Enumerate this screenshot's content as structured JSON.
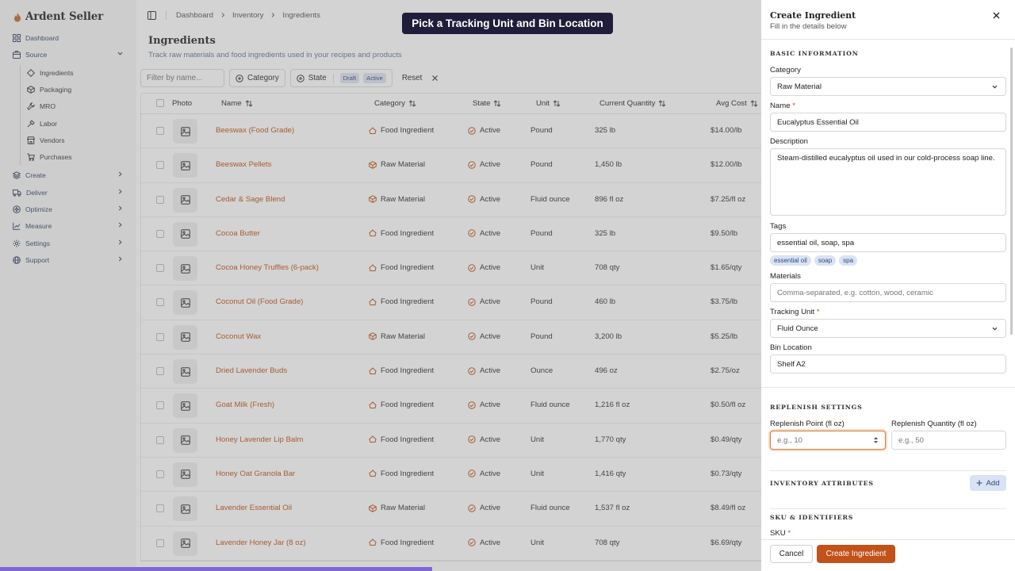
{
  "brand": {
    "name": "Ardent Seller"
  },
  "sidebar": {
    "items": [
      {
        "label": "Dashboard",
        "icon": "grid-icon"
      },
      {
        "label": "Source",
        "icon": "box-icon",
        "expanded": true
      },
      {
        "label": "Create",
        "icon": "layers-icon"
      },
      {
        "label": "Deliver",
        "icon": "truck-icon"
      },
      {
        "label": "Optimize",
        "icon": "sparkle-icon"
      },
      {
        "label": "Measure",
        "icon": "chart-icon"
      },
      {
        "label": "Settings",
        "icon": "gear-icon"
      },
      {
        "label": "Support",
        "icon": "globe-icon"
      }
    ],
    "source_items": [
      {
        "label": "Ingredients",
        "icon": "diamond-icon"
      },
      {
        "label": "Packaging",
        "icon": "package-icon"
      },
      {
        "label": "MRO",
        "icon": "wrench-icon"
      },
      {
        "label": "Labor",
        "icon": "hammer-icon"
      },
      {
        "label": "Vendors",
        "icon": "store-icon"
      },
      {
        "label": "Purchases",
        "icon": "cart-icon"
      }
    ]
  },
  "breadcrumb": [
    "Dashboard",
    "Inventory",
    "Ingredients"
  ],
  "page": {
    "title": "Ingredients",
    "subtitle": "Track raw materials and food ingredients used in your recipes and products"
  },
  "filters": {
    "placeholder": "Filter by name...",
    "category_label": "Category",
    "state_label": "State",
    "state_chips": [
      "Draft",
      "Active"
    ],
    "reset_label": "Reset"
  },
  "table": {
    "columns": [
      "Photo",
      "Name",
      "Category",
      "State",
      "Unit",
      "Current Quantity",
      "Avg Cost"
    ],
    "rows": [
      {
        "name": "Beeswax (Food Grade)",
        "category": "Food Ingredient",
        "state": "Active",
        "unit": "Pound",
        "qty": "325 lb",
        "cost": "$14.00/lb"
      },
      {
        "name": "Beeswax Pellets",
        "category": "Raw Material",
        "state": "Active",
        "unit": "Pound",
        "qty": "1,450 lb",
        "cost": "$12.00/lb"
      },
      {
        "name": "Cedar & Sage Blend",
        "category": "Raw Material",
        "state": "Active",
        "unit": "Fluid ounce",
        "qty": "896 fl oz",
        "cost": "$7.25/fl oz"
      },
      {
        "name": "Cocoa Butter",
        "category": "Food Ingredient",
        "state": "Active",
        "unit": "Pound",
        "qty": "325 lb",
        "cost": "$9.50/lb"
      },
      {
        "name": "Cocoa Honey Truffles (6-pack)",
        "category": "Food Ingredient",
        "state": "Active",
        "unit": "Unit",
        "qty": "708 qty",
        "cost": "$1.65/qty"
      },
      {
        "name": "Coconut Oil (Food Grade)",
        "category": "Food Ingredient",
        "state": "Active",
        "unit": "Pound",
        "qty": "460 lb",
        "cost": "$3.75/lb"
      },
      {
        "name": "Coconut Wax",
        "category": "Raw Material",
        "state": "Active",
        "unit": "Pound",
        "qty": "3,200 lb",
        "cost": "$5.25/lb"
      },
      {
        "name": "Dried Lavender Buds",
        "category": "Food Ingredient",
        "state": "Active",
        "unit": "Ounce",
        "qty": "496 oz",
        "cost": "$2.75/oz"
      },
      {
        "name": "Goat Milk (Fresh)",
        "category": "Food Ingredient",
        "state": "Active",
        "unit": "Fluid ounce",
        "qty": "1,216 fl oz",
        "cost": "$0.50/fl oz"
      },
      {
        "name": "Honey Lavender Lip Balm",
        "category": "Food Ingredient",
        "state": "Active",
        "unit": "Unit",
        "qty": "1,770 qty",
        "cost": "$0.49/qty"
      },
      {
        "name": "Honey Oat Granola Bar",
        "category": "Food Ingredient",
        "state": "Active",
        "unit": "Unit",
        "qty": "1,416 qty",
        "cost": "$0.73/qty"
      },
      {
        "name": "Lavender Essential Oil",
        "category": "Raw Material",
        "state": "Active",
        "unit": "Fluid ounce",
        "qty": "1,537 fl oz",
        "cost": "$8.49/fl oz"
      },
      {
        "name": "Lavender Honey Jar (8 oz)",
        "category": "Food Ingredient",
        "state": "Active",
        "unit": "Unit",
        "qty": "708 qty",
        "cost": "$6.69/qty"
      }
    ]
  },
  "tooltip": "Pick a Tracking Unit and Bin Location",
  "panel": {
    "title": "Create Ingredient",
    "subtitle": "Fill in the details below",
    "basic_section": "BASIC INFORMATION",
    "category_label": "Category",
    "category_value": "Raw Material",
    "name_label": "Name",
    "name_value": "Eucalyptus Essential Oil",
    "description_label": "Description",
    "description_value": "Steam-distilled eucalyptus oil used in our cold-process soap line.",
    "tags_label": "Tags",
    "tags_value": "essential oil, soap, spa",
    "tags": [
      "essential oil",
      "soap",
      "spa"
    ],
    "materials_label": "Materials",
    "materials_placeholder": "Comma-separated, e.g. cotton, wood, ceramic",
    "tracking_label": "Tracking Unit",
    "tracking_value": "Fluid Ounce",
    "bin_label": "Bin Location",
    "bin_value": "Shelf A2",
    "replenish_section": "REPLENISH SETTINGS",
    "rp_label": "Replenish Point (fl oz)",
    "rp_placeholder": "e.g., 10",
    "rq_label": "Replenish Quantity (fl oz)",
    "rq_placeholder": "e.g., 50",
    "attributes_section": "INVENTORY ATTRIBUTES",
    "add_label": "Add",
    "sku_section": "SKU & IDENTIFIERS",
    "sku_label": "SKU",
    "cancel_label": "Cancel",
    "create_label": "Create Ingredient"
  },
  "colors": {
    "accent": "#c2521a",
    "link": "#c0561b",
    "tooltip_bg": "#1f1d3a",
    "progress": "#8a63ff"
  }
}
